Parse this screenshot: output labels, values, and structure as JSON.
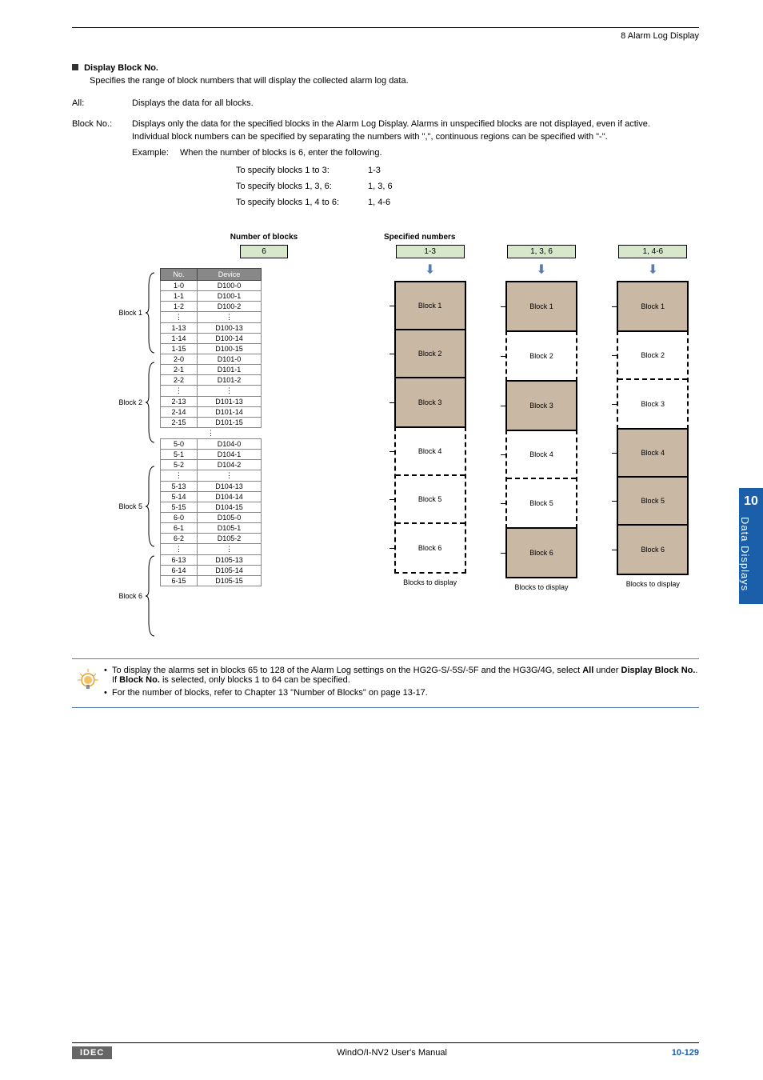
{
  "header": {
    "breadcrumb": "8 Alarm Log Display"
  },
  "section": {
    "title": "Display Block No.",
    "desc": "Specifies the range of block numbers that will display the collected alarm log data.",
    "rows": [
      {
        "term": "All:",
        "def1": "Displays the data for all blocks."
      },
      {
        "term": "Block No.:",
        "def1": "Displays only the data for the specified blocks in the Alarm Log Display. Alarms in unspecified blocks are not displayed, even if active.",
        "def2": "Individual block numbers can be specified by separating the numbers with \",\", continuous regions can be specified with \"-\"."
      }
    ],
    "example_label": "Example:",
    "example_text": "When the number of blocks is 6, enter the following.",
    "spec_lines": [
      {
        "l": "To specify blocks 1 to 3:",
        "r": "1-3"
      },
      {
        "l": "To specify blocks 1, 3, 6:",
        "r": "1, 3, 6"
      },
      {
        "l": "To specify blocks 1, 4 to 6:",
        "r": "1, 4-6"
      }
    ]
  },
  "diagram": {
    "left_title": "Number of blocks",
    "num_blocks": "6",
    "table_headers": {
      "no": "No.",
      "device": "Device"
    },
    "groups": [
      {
        "label": "Block 1",
        "rows": [
          [
            "1-0",
            "D100-0"
          ],
          [
            "1-1",
            "D100-1"
          ],
          [
            "1-2",
            "D100-2"
          ],
          [
            "⋮",
            "⋮"
          ],
          [
            "1-13",
            "D100-13"
          ],
          [
            "1-14",
            "D100-14"
          ],
          [
            "1-15",
            "D100-15"
          ]
        ]
      },
      {
        "label": "Block 2",
        "rows": [
          [
            "2-0",
            "D101-0"
          ],
          [
            "2-1",
            "D101-1"
          ],
          [
            "2-2",
            "D101-2"
          ],
          [
            "⋮",
            "⋮"
          ],
          [
            "2-13",
            "D101-13"
          ],
          [
            "2-14",
            "D101-14"
          ],
          [
            "2-15",
            "D101-15"
          ]
        ]
      },
      {
        "label": "Block 5",
        "rows": [
          [
            "5-0",
            "D104-0"
          ],
          [
            "5-1",
            "D104-1"
          ],
          [
            "5-2",
            "D104-2"
          ],
          [
            "⋮",
            "⋮"
          ],
          [
            "5-13",
            "D104-13"
          ],
          [
            "5-14",
            "D104-14"
          ],
          [
            "5-15",
            "D104-15"
          ]
        ]
      },
      {
        "label": "Block 6",
        "rows": [
          [
            "6-0",
            "D105-0"
          ],
          [
            "6-1",
            "D105-1"
          ],
          [
            "6-2",
            "D105-2"
          ],
          [
            "⋮",
            "⋮"
          ],
          [
            "6-13",
            "D105-13"
          ],
          [
            "6-14",
            "D105-14"
          ],
          [
            "6-15",
            "D105-15"
          ]
        ]
      }
    ],
    "vdots": "⋮",
    "right_title": "Specified numbers",
    "spec_cols": [
      {
        "spec": "1-3",
        "blocks": [
          "Block 1",
          "Block 2",
          "Block 3",
          "Block 4",
          "Block 5",
          "Block 6"
        ],
        "filled": [
          0,
          1,
          2
        ],
        "caption": "Blocks to display"
      },
      {
        "spec": "1, 3, 6",
        "blocks": [
          "Block 1",
          "Block 2",
          "Block 3",
          "Block 4",
          "Block 5",
          "Block 6"
        ],
        "filled": [
          0,
          2,
          5
        ],
        "caption": "Blocks to display"
      },
      {
        "spec": "1, 4-6",
        "blocks": [
          "Block 1",
          "Block 2",
          "Block 3",
          "Block 4",
          "Block 5",
          "Block 6"
        ],
        "filled": [
          0,
          3,
          4,
          5
        ],
        "caption": "Blocks to display"
      }
    ]
  },
  "notes": {
    "n1a": "To display the alarms set in blocks 65 to 128 of the Alarm Log settings on the HG2G-S/-5S/-5F and the HG3G/4G, select ",
    "n1b": "All",
    "n1c": " under ",
    "n1d": "Display Block No.",
    "n1e": ". If ",
    "n1f": "Block No.",
    "n1g": " is selected, only blocks 1 to 64 can be specified.",
    "n2": "For the number of blocks, refer to Chapter 13 \"Number of Blocks\" on page 13-17."
  },
  "sidebar": {
    "num": "10",
    "txt": "Data Displays"
  },
  "footer": {
    "brand": "IDEC",
    "mid": "WindO/I-NV2 User's Manual",
    "pg": "10-129"
  }
}
